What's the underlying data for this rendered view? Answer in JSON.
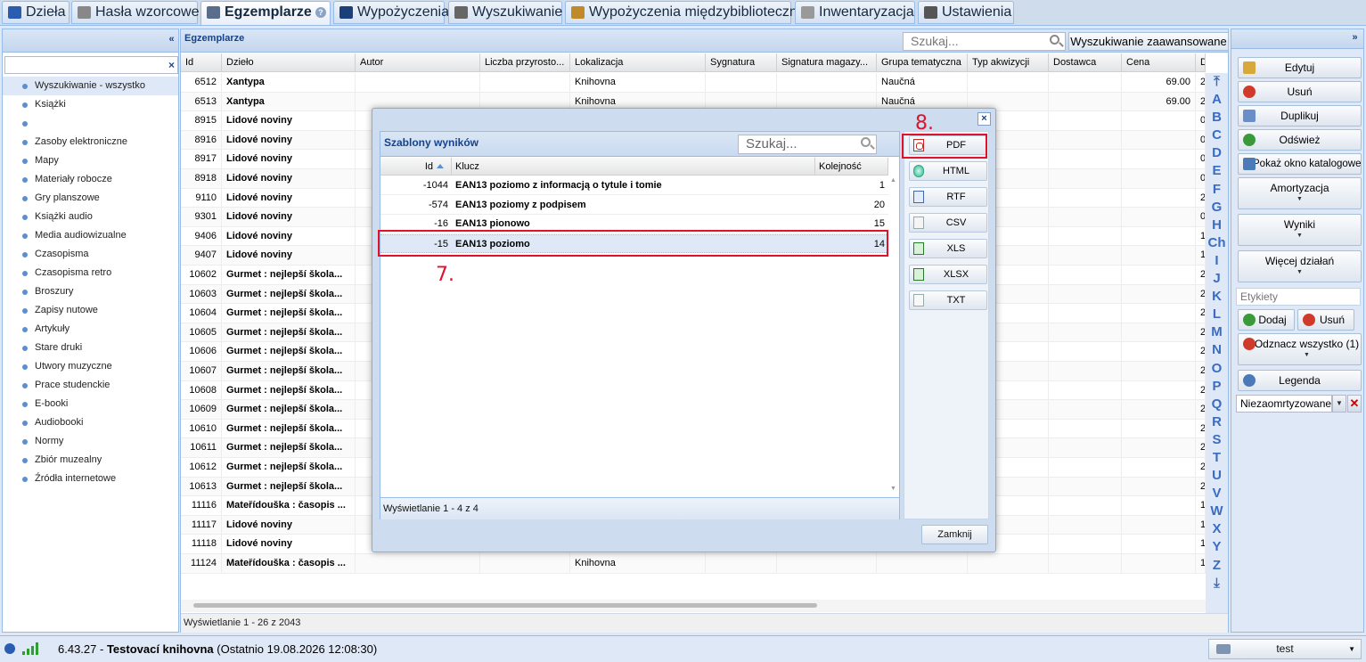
{
  "tabs": [
    {
      "label": "Dzieła",
      "icon": "book-icon",
      "color": "#2a5db0"
    },
    {
      "label": "Hasła wzorcowe",
      "icon": "authority-icon",
      "color": "#777777"
    },
    {
      "label": "Egzemplarze",
      "icon": "item-icon",
      "color": "#5a6e8c",
      "active": true
    },
    {
      "label": "Wypożyczenia",
      "icon": "loan-icon",
      "color": "#1b3f7a"
    },
    {
      "label": "Wyszukiwanie",
      "icon": "search-tab-icon",
      "color": "#666666"
    },
    {
      "label": "Wypożyczenia międzybiblioteczne",
      "icon": "package-icon",
      "color": "#c08a2a"
    },
    {
      "label": "Inwentaryzacja",
      "icon": "inventory-icon",
      "color": "#888888"
    },
    {
      "label": "Ustawienia",
      "icon": "tools-icon",
      "color": "#555555"
    }
  ],
  "left": {
    "collapse": "«",
    "filter_clear": "×",
    "items": [
      "Wyszukiwanie - wszystko",
      "Książki",
      "",
      "Zasoby elektroniczne",
      "Mapy",
      "Materiały robocze",
      "Gry planszowe",
      "Książki audio",
      "Media audiowizualne",
      "Czasopisma",
      "Czasopisma retro",
      "Broszury",
      "Zapisy nutowe",
      "Artykuły",
      "Stare druki",
      "Utwory muzyczne",
      "Prace studenckie",
      "E-booki",
      "Audiobooki",
      "Normy",
      "Zbiór muzealny",
      "Źródła internetowe"
    ]
  },
  "main": {
    "title": "Egzemplarze",
    "search_placeholder": "Szukaj...",
    "advanced_search": "Wyszukiwanie zaawansowane",
    "columns": [
      "Id",
      "Dzieło",
      "Autor",
      "Liczba przyrosto...",
      "Lokalizacja",
      "Sygnatura",
      "Signatura magazy...",
      "Grupa tematyczna",
      "Typ akwizycji",
      "Dostawca",
      "Cena",
      "D"
    ],
    "rows": [
      {
        "id": "6512",
        "title": "Xantypa",
        "loc": "Knihovna",
        "group": "Naučná",
        "price": "69.00",
        "d": "2"
      },
      {
        "id": "6513",
        "title": "Xantypa",
        "loc": "Knihovna",
        "group": "Naučná",
        "price": "69.00",
        "d": "2"
      },
      {
        "id": "8915",
        "title": "Lidové noviny",
        "loc": "",
        "group": "",
        "price": "",
        "d": "0"
      },
      {
        "id": "8916",
        "title": "Lidové noviny",
        "loc": "",
        "group": "",
        "price": "",
        "d": "0"
      },
      {
        "id": "8917",
        "title": "Lidové noviny",
        "loc": "",
        "group": "",
        "price": "",
        "d": "0"
      },
      {
        "id": "8918",
        "title": "Lidové noviny",
        "loc": "",
        "group": "",
        "price": "",
        "d": "0"
      },
      {
        "id": "9110",
        "title": "Lidové noviny",
        "loc": "",
        "group": "",
        "price": "",
        "d": "2"
      },
      {
        "id": "9301",
        "title": "Lidové noviny",
        "loc": "",
        "group": "",
        "price": "",
        "d": "0"
      },
      {
        "id": "9406",
        "title": "Lidové noviny",
        "loc": "",
        "group": "",
        "price": "",
        "d": "1"
      },
      {
        "id": "9407",
        "title": "Lidové noviny",
        "loc": "",
        "group": "",
        "price": "",
        "d": "1"
      },
      {
        "id": "10602",
        "title": "Gurmet : nejlepší škola...",
        "loc": "",
        "group": "",
        "price": "",
        "d": "2"
      },
      {
        "id": "10603",
        "title": "Gurmet : nejlepší škola...",
        "loc": "",
        "group": "",
        "price": "",
        "d": "2"
      },
      {
        "id": "10604",
        "title": "Gurmet : nejlepší škola...",
        "loc": "",
        "group": "",
        "price": "",
        "d": "2"
      },
      {
        "id": "10605",
        "title": "Gurmet : nejlepší škola...",
        "loc": "",
        "group": "",
        "price": "",
        "d": "2"
      },
      {
        "id": "10606",
        "title": "Gurmet : nejlepší škola...",
        "loc": "",
        "group": "",
        "price": "",
        "d": "2"
      },
      {
        "id": "10607",
        "title": "Gurmet : nejlepší škola...",
        "loc": "",
        "group": "",
        "price": "",
        "d": "2"
      },
      {
        "id": "10608",
        "title": "Gurmet : nejlepší škola...",
        "loc": "",
        "group": "",
        "price": "",
        "d": "2"
      },
      {
        "id": "10609",
        "title": "Gurmet : nejlepší škola...",
        "loc": "",
        "group": "",
        "price": "",
        "d": "2"
      },
      {
        "id": "10610",
        "title": "Gurmet : nejlepší škola...",
        "loc": "",
        "group": "",
        "price": "",
        "d": "2"
      },
      {
        "id": "10611",
        "title": "Gurmet : nejlepší škola...",
        "loc": "",
        "group": "",
        "price": "",
        "d": "2"
      },
      {
        "id": "10612",
        "title": "Gurmet : nejlepší škola...",
        "loc": "",
        "group": "",
        "price": "",
        "d": "2"
      },
      {
        "id": "10613",
        "title": "Gurmet : nejlepší škola...",
        "loc": "",
        "group": "",
        "price": "",
        "d": "2"
      },
      {
        "id": "11116",
        "title": "Mateřídouška : časopis ...",
        "loc": "",
        "group": "",
        "price": "",
        "d": "1"
      },
      {
        "id": "11117",
        "title": "Lidové noviny",
        "loc": "",
        "group": "",
        "price": "",
        "d": "1"
      },
      {
        "id": "11118",
        "title": "Lidové noviny",
        "loc": "",
        "group": "",
        "price": "",
        "d": "1"
      },
      {
        "id": "11124",
        "title": "Mateřídouška : časopis ...",
        "loc": "Knihovna",
        "group": "",
        "price": "",
        "d": "1"
      }
    ],
    "footer": "Wyświetlanie 1 - 26 z 2043",
    "alphabet": [
      "⤒",
      "A",
      "B",
      "C",
      "D",
      "E",
      "F",
      "G",
      "H",
      "Ch",
      "I",
      "J",
      "K",
      "L",
      "M",
      "N",
      "O",
      "P",
      "Q",
      "R",
      "S",
      "T",
      "U",
      "V",
      "W",
      "X",
      "Y",
      "Z",
      "⤓"
    ]
  },
  "right": {
    "collapse": "»",
    "buttons": [
      {
        "label": "Edytuj",
        "icon": "edit-icon",
        "color": "#d8a93a"
      },
      {
        "label": "Usuń",
        "icon": "delete-icon",
        "color": "#d03a2a"
      },
      {
        "label": "Duplikuj",
        "icon": "duplicate-icon",
        "color": "#6a8fc8"
      },
      {
        "label": "Odśwież",
        "icon": "refresh-icon",
        "color": "#3a9a3a"
      },
      {
        "label": "Pokaż okno katalogowe",
        "icon": "catalog-icon",
        "color": "#4a7ab8"
      }
    ],
    "menus": [
      "Amortyzacja",
      "Wyniki",
      "Więcej działań"
    ],
    "labels_placeholder": "Etykiety",
    "add_label": "Dodaj",
    "remove_label": "Usuń",
    "unmark_all": "Odznacz wszystko (1)",
    "legend": "Legenda",
    "select_value": "Niezaomrtyzowane",
    "clear": "✕"
  },
  "status": {
    "version": "6.43.27",
    "library": "Testovací knihovna",
    "last": "(Ostatnio 19.08.2026 12:08:30)",
    "user": "test"
  },
  "modal": {
    "close": "×",
    "title": "Szablony wyników",
    "search_placeholder": "Szukaj...",
    "columns": [
      "Id",
      "Klucz",
      "Kolejność"
    ],
    "rows": [
      {
        "id": "-1044",
        "key": "EAN13 poziomo z informacją o tytule i tomie",
        "order": "1"
      },
      {
        "id": "-574",
        "key": "EAN13 poziomy z podpisem",
        "order": "20"
      },
      {
        "id": "-16",
        "key": "EAN13 pionowo",
        "order": "15"
      },
      {
        "id": "-15",
        "key": "EAN13 poziomo",
        "order": "14",
        "selected": true
      }
    ],
    "footer": "Wyświetlanie 1 - 4 z 4",
    "formats": [
      "PDF",
      "HTML",
      "RTF",
      "CSV",
      "XLS",
      "XLSX",
      "TXT"
    ],
    "close_button": "Zamknij"
  },
  "annotations": {
    "step7": "7.",
    "step8": "8.",
    "color": "#e0122b"
  }
}
